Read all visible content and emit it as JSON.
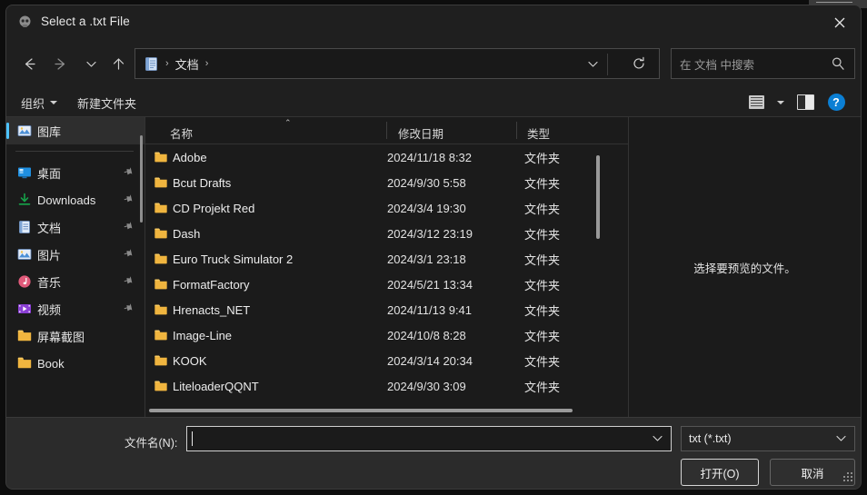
{
  "window": {
    "title": "Select a .txt File",
    "icon": "app-icon",
    "close_label": "✕"
  },
  "nav": {
    "back_icon": "arrow-left-icon",
    "forward_icon": "arrow-right-icon",
    "recent_icon": "chevron-down-icon",
    "up_icon": "arrow-up-icon",
    "address": {
      "icon": "documents-icon",
      "crumbs": [
        "文档"
      ],
      "separator": "›",
      "dropdown_icon": "chevron-down-icon",
      "refresh_icon": "refresh-icon"
    },
    "search": {
      "placeholder": "在 文档 中搜索",
      "value": "",
      "icon": "search-icon"
    }
  },
  "command_bar": {
    "organize_label": "组织",
    "new_folder_label": "新建文件夹",
    "view_icon": "view-list-icon",
    "view_dropdown_icon": "chevron-down-icon",
    "preview_pane_icon": "preview-pane-icon",
    "help_icon": "help-icon",
    "help_label": "?"
  },
  "sidebar": {
    "selected_index": 0,
    "items": [
      {
        "label": "图库",
        "icon": "gallery-icon",
        "pinned": false,
        "selected": true
      },
      {
        "label": "桌面",
        "icon": "desktop-icon",
        "pinned": true,
        "selected": false
      },
      {
        "label": "Downloads",
        "icon": "downloads-icon",
        "pinned": true,
        "selected": false
      },
      {
        "label": "文档",
        "icon": "documents-icon",
        "pinned": true,
        "selected": false
      },
      {
        "label": "图片",
        "icon": "pictures-icon",
        "pinned": true,
        "selected": false
      },
      {
        "label": "音乐",
        "icon": "music-icon",
        "pinned": true,
        "selected": false
      },
      {
        "label": "视频",
        "icon": "videos-icon",
        "pinned": true,
        "selected": false
      },
      {
        "label": "屏幕截图",
        "icon": "folder-icon",
        "pinned": false,
        "selected": false
      },
      {
        "label": "Book",
        "icon": "folder-icon",
        "pinned": false,
        "selected": false
      }
    ],
    "pin_glyph": "📌"
  },
  "file_list": {
    "columns": [
      "名称",
      "修改日期",
      "类型"
    ],
    "sort_column": "名称",
    "sort_caret": "⌃",
    "rows": [
      {
        "name": "Adobe",
        "date": "2024/11/18 8:32",
        "type": "文件夹",
        "icon": "folder-icon"
      },
      {
        "name": "Bcut Drafts",
        "date": "2024/9/30 5:58",
        "type": "文件夹",
        "icon": "folder-icon"
      },
      {
        "name": "CD Projekt Red",
        "date": "2024/3/4 19:30",
        "type": "文件夹",
        "icon": "folder-icon"
      },
      {
        "name": "Dash",
        "date": "2024/3/12 23:19",
        "type": "文件夹",
        "icon": "folder-icon"
      },
      {
        "name": "Euro Truck Simulator 2",
        "date": "2024/3/1 23:18",
        "type": "文件夹",
        "icon": "folder-icon"
      },
      {
        "name": "FormatFactory",
        "date": "2024/5/21 13:34",
        "type": "文件夹",
        "icon": "folder-icon"
      },
      {
        "name": "Hrenacts_NET",
        "date": "2024/11/13 9:41",
        "type": "文件夹",
        "icon": "folder-icon"
      },
      {
        "name": "Image-Line",
        "date": "2024/10/8 8:28",
        "type": "文件夹",
        "icon": "folder-icon"
      },
      {
        "name": "KOOK",
        "date": "2024/3/14 20:34",
        "type": "文件夹",
        "icon": "folder-icon"
      },
      {
        "name": "LiteloaderQQNT",
        "date": "2024/9/30 3:09",
        "type": "文件夹",
        "icon": "folder-icon"
      }
    ]
  },
  "preview_pane": {
    "message": "选择要预览的文件。"
  },
  "footer": {
    "filename_label": "文件名(N):",
    "filename_value": "",
    "filename_dropdown_icon": "chevron-down-icon",
    "filter_value": "txt (*.txt)",
    "filter_dropdown_icon": "chevron-down-icon",
    "open_label": "打开(O)",
    "cancel_label": "取消",
    "resize_grip_icon": "resize-grip-icon"
  },
  "colors": {
    "accent": "#4cc2ff",
    "help_blue": "#0b7fd4",
    "folder_yellow": "#f5b942",
    "window_bg": "#2b2b2b",
    "content_bg": "#1b1b1b",
    "chrome_bg": "#1f1f1f"
  }
}
